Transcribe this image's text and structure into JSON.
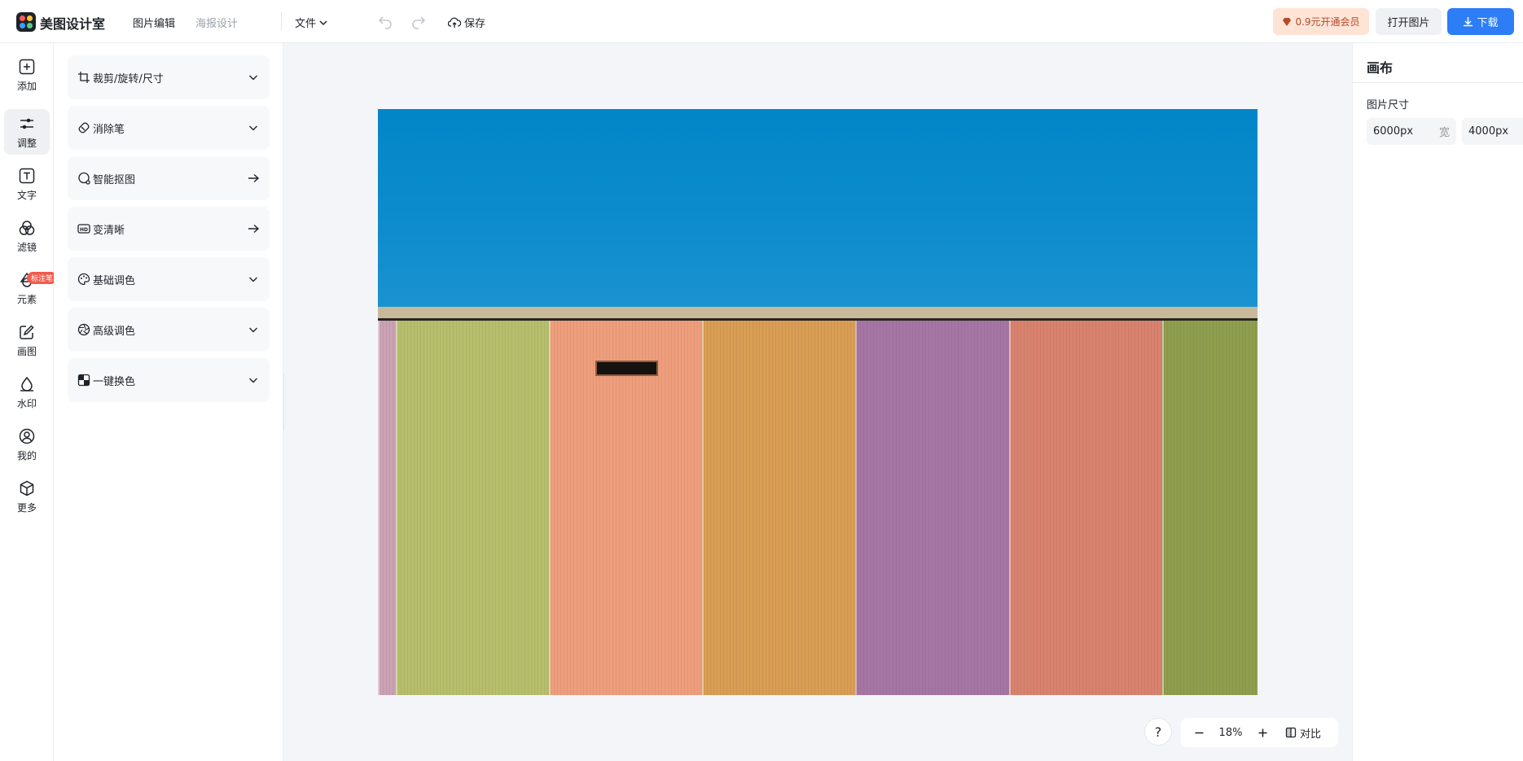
{
  "app": {
    "brand": "美图设计室"
  },
  "header": {
    "tabs": [
      {
        "label": "图片编辑",
        "active": true
      },
      {
        "label": "海报设计",
        "active": false
      }
    ],
    "file_menu": "文件",
    "save_label": "保存",
    "vip_label": "0.9元开通会员",
    "open_label": "打开图片",
    "download_label": "下载"
  },
  "rail": {
    "items": [
      {
        "label": "添加",
        "icon": "plus-square-icon"
      },
      {
        "label": "调整",
        "icon": "sliders-icon",
        "active": true
      },
      {
        "label": "文字",
        "icon": "text-icon"
      },
      {
        "label": "滤镜",
        "icon": "filter-circles-icon"
      },
      {
        "label": "元素",
        "icon": "shapes-icon"
      },
      {
        "label": "画图",
        "icon": "draw-icon"
      },
      {
        "label": "水印",
        "icon": "watermark-icon"
      },
      {
        "label": "我的",
        "icon": "user-icon"
      },
      {
        "label": "更多",
        "icon": "cube-icon"
      }
    ],
    "badge": "标注笔"
  },
  "tools": [
    {
      "label": "裁剪/旋转/尺寸",
      "icon": "crop-icon",
      "action": "chevron-down-icon"
    },
    {
      "label": "消除笔",
      "icon": "eraser-icon",
      "action": "chevron-down-icon"
    },
    {
      "label": "智能抠图",
      "icon": "cutout-icon",
      "action": "arrow-right-icon"
    },
    {
      "label": "变清晰",
      "icon": "hd-icon",
      "action": "arrow-right-icon"
    },
    {
      "label": "基础调色",
      "icon": "palette-icon",
      "action": "chevron-down-icon"
    },
    {
      "label": "高级调色",
      "icon": "aperture-icon",
      "action": "chevron-down-icon"
    },
    {
      "label": "一键换色",
      "icon": "swap-color-icon",
      "action": "chevron-down-icon"
    }
  ],
  "canvas": {
    "zoom": "18%",
    "compare_label": "对比",
    "help_label": "?"
  },
  "right_panel": {
    "title": "画布",
    "size_label": "图片尺寸",
    "width_value": "6000px",
    "width_unit": "宽",
    "height_value": "4000px"
  },
  "colors": {
    "accent": "#2d7df6",
    "sky": "#0286c7",
    "stripes": [
      "#c9a2b4",
      "#b7be6c",
      "#ee9e7c",
      "#d99d54",
      "#a576a4",
      "#d8836f",
      "#8f9e4e"
    ]
  }
}
